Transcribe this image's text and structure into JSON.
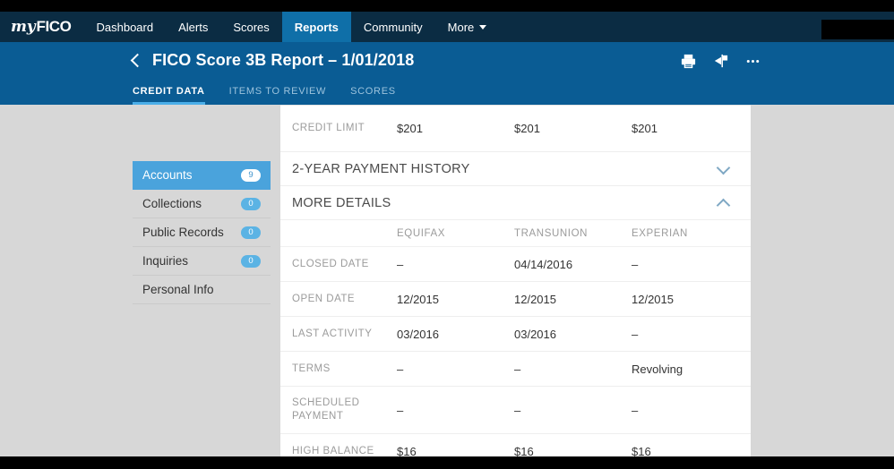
{
  "brand": {
    "logo_my": "my",
    "logo_fico": "FICO"
  },
  "nav": {
    "items": [
      {
        "label": "Dashboard",
        "active": false
      },
      {
        "label": "Alerts",
        "active": false
      },
      {
        "label": "Scores",
        "active": false
      },
      {
        "label": "Reports",
        "active": true
      },
      {
        "label": "Community",
        "active": false
      },
      {
        "label": "More",
        "active": false,
        "has_caret": true
      }
    ]
  },
  "report": {
    "title": "FICO Score 3B Report – 1/01/2018",
    "back_label": "Back",
    "actions": [
      {
        "name": "print-icon",
        "label": "Print"
      },
      {
        "name": "share-icon",
        "label": "Share"
      },
      {
        "name": "more-options-icon",
        "label": "More options"
      }
    ],
    "tabs": [
      {
        "label": "CREDIT DATA",
        "active": true
      },
      {
        "label": "ITEMS TO REVIEW",
        "active": false
      },
      {
        "label": "SCORES",
        "active": false
      }
    ]
  },
  "sidebar": {
    "items": [
      {
        "label": "Accounts",
        "count": "9",
        "active": true
      },
      {
        "label": "Collections",
        "count": "0",
        "active": false
      },
      {
        "label": "Public Records",
        "count": "0",
        "active": false
      },
      {
        "label": "Inquiries",
        "count": "0",
        "active": false
      },
      {
        "label": "Personal Info",
        "count": null,
        "active": false
      }
    ]
  },
  "main": {
    "credit_limit": {
      "label": "CREDIT LIMIT",
      "equifax": "$201",
      "transunion": "$201",
      "experian": "$201"
    },
    "sections": [
      {
        "title": "2-YEAR PAYMENT HISTORY",
        "expanded": false
      },
      {
        "title": "MORE DETAILS",
        "expanded": true
      }
    ],
    "more_details": {
      "columns": [
        "",
        "EQUIFAX",
        "TRANSUNION",
        "EXPERIAN"
      ],
      "rows": [
        {
          "label": "CLOSED DATE",
          "equifax": "–",
          "transunion": "04/14/2016",
          "experian": "–"
        },
        {
          "label": "OPEN DATE",
          "equifax": "12/2015",
          "transunion": "12/2015",
          "experian": "12/2015"
        },
        {
          "label": "LAST ACTIVITY",
          "equifax": "03/2016",
          "transunion": "03/2016",
          "experian": "–"
        },
        {
          "label": "TERMS",
          "equifax": "–",
          "transunion": "–",
          "experian": "Revolving"
        },
        {
          "label": "SCHEDULED PAYMENT",
          "equifax": "–",
          "transunion": "–",
          "experian": "–"
        },
        {
          "label": "HIGH BALANCE",
          "equifax": "$16",
          "transunion": "$16",
          "experian": "$16"
        }
      ]
    }
  },
  "colors": {
    "nav_bar": "#0b2c43",
    "nav_active": "#0f6fa8",
    "header_band": "#0a5c94",
    "tab_underline": "#4aaee8",
    "sidebar_active": "#4aa3dc",
    "badge": "#5bb3e4",
    "page_bg": "#d7d7d7",
    "chevron": "#7fa8c4"
  }
}
